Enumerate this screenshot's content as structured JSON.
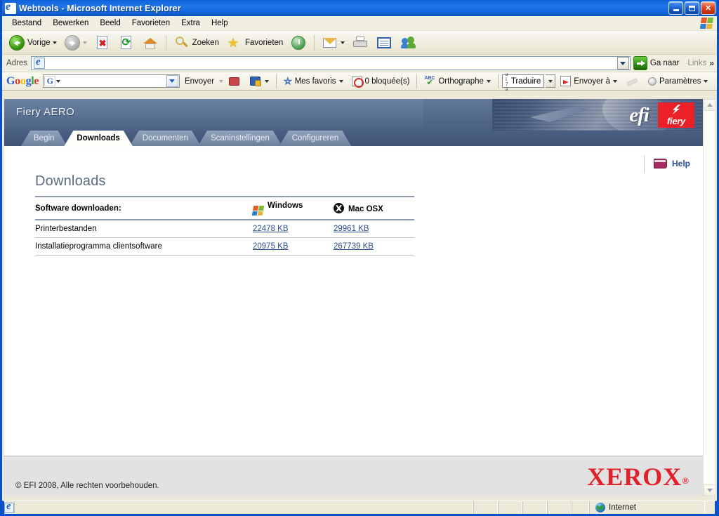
{
  "window": {
    "title": "Webtools - Microsoft Internet Explorer",
    "icon": "ie-document-icon",
    "buttons": {
      "minimize": "minimize-button",
      "maximize": "maximize-button",
      "close": "close-button"
    }
  },
  "menubar": {
    "items": [
      "Bestand",
      "Bewerken",
      "Beeld",
      "Favorieten",
      "Extra",
      "Help"
    ]
  },
  "toolbar": {
    "back_label": "Vorige",
    "forward_label": "",
    "stop_label": "",
    "refresh_label": "",
    "home_label": "",
    "search_label": "Zoeken",
    "favorites_label": "Favorieten",
    "history_label": "",
    "mail_label": "",
    "print_label": "",
    "edit_label": "",
    "messenger_label": ""
  },
  "address_bar": {
    "label": "Adres",
    "value": "",
    "placeholder": "",
    "go_label": "Ga naar",
    "links_label": "Links",
    "chevron": "»"
  },
  "google_toolbar": {
    "logo": [
      "G",
      "o",
      "o",
      "g",
      "l",
      "e"
    ],
    "search_value": "",
    "search_placeholder": "",
    "box_badge": "G",
    "send_label": "Envoyer",
    "my_favorites_label": "Mes favoris",
    "blocked_label": "0 bloquée(s)",
    "spelling_label": "Orthographe",
    "translate_label": "Traduire",
    "translate_glyph": "a í\n7 á",
    "send_to_label": "Envoyer à",
    "settings_label": "Paramètres"
  },
  "banner": {
    "product_title": "Fiery AERO",
    "efi_logo": "efi",
    "fiery_logo": "fiery"
  },
  "tabs": [
    {
      "label": "Begin",
      "active": false
    },
    {
      "label": "Downloads",
      "active": true
    },
    {
      "label": "Documenten",
      "active": false
    },
    {
      "label": "Scaninstellingen",
      "active": false
    },
    {
      "label": "Configureren",
      "active": false
    }
  ],
  "content": {
    "help_label": "Help",
    "page_title": "Downloads",
    "table": {
      "headers": {
        "name": "Software downloaden:",
        "windows": "Windows",
        "mac": "Mac OSX"
      },
      "rows": [
        {
          "name": "Printerbestanden",
          "windows": "22478 KB",
          "mac": "29961 KB"
        },
        {
          "name": "Installatieprogramma clientsoftware",
          "windows": "20975 KB",
          "mac": "267739 KB"
        }
      ]
    }
  },
  "footer": {
    "copyright": "© EFI 2008, Alle rechten voorbehouden.",
    "brand": "XEROX",
    "brand_mark": "®"
  },
  "statusbar": {
    "zone": "Internet"
  },
  "colors": {
    "titlebar_blue": "#1f74e8",
    "window_border": "#0a51c8",
    "banner_slate": "#4a6083",
    "link_blue": "#2b4f8e",
    "xerox_red": "#e0202a",
    "fiery_red": "#ec2027",
    "page_title_gray": "#5a6a80"
  }
}
